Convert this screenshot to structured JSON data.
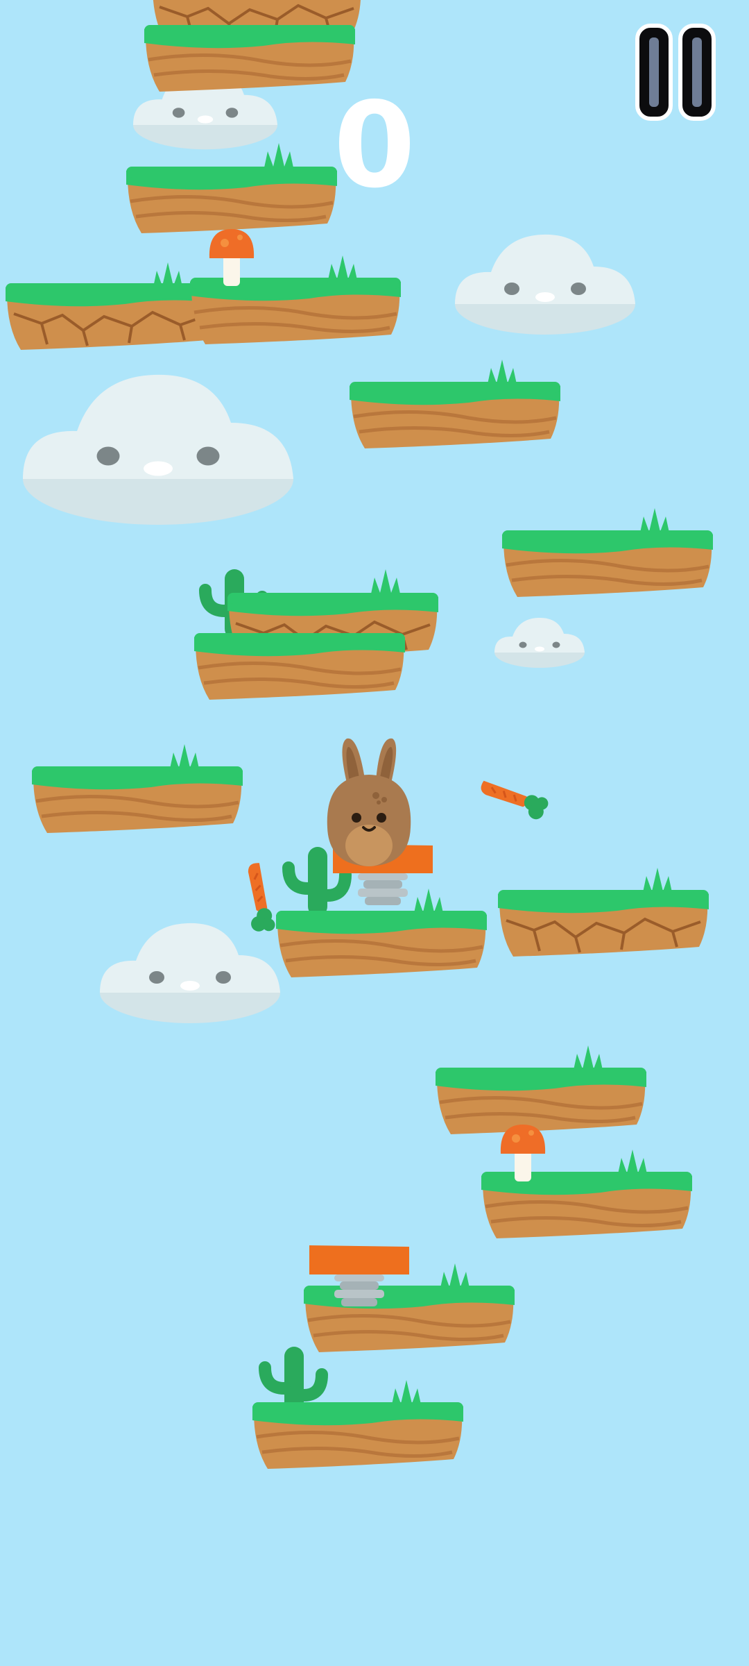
{
  "hud": {
    "score": "0",
    "pause_icon": "pause-icon"
  },
  "colors": {
    "sky": "#aee5fa",
    "grass": "#2dc76b",
    "dirt": "#cf8f4c",
    "cloud": "#e6f1f3",
    "bunny": "#a97a4f",
    "carrot": "#ee6f25",
    "spring": "#ee6f1e",
    "cactus": "#2aaa5c",
    "mushroom_cap": "#ef6d27"
  },
  "game": {
    "player": "bunny",
    "platform_count": 16,
    "cracked_platform_count": 4,
    "collectibles": [
      "carrot",
      "carrot"
    ],
    "powerups": [
      "spring",
      "spring"
    ],
    "decorations": [
      "mushroom",
      "mushroom",
      "cactus",
      "cactus",
      "cactus"
    ]
  }
}
